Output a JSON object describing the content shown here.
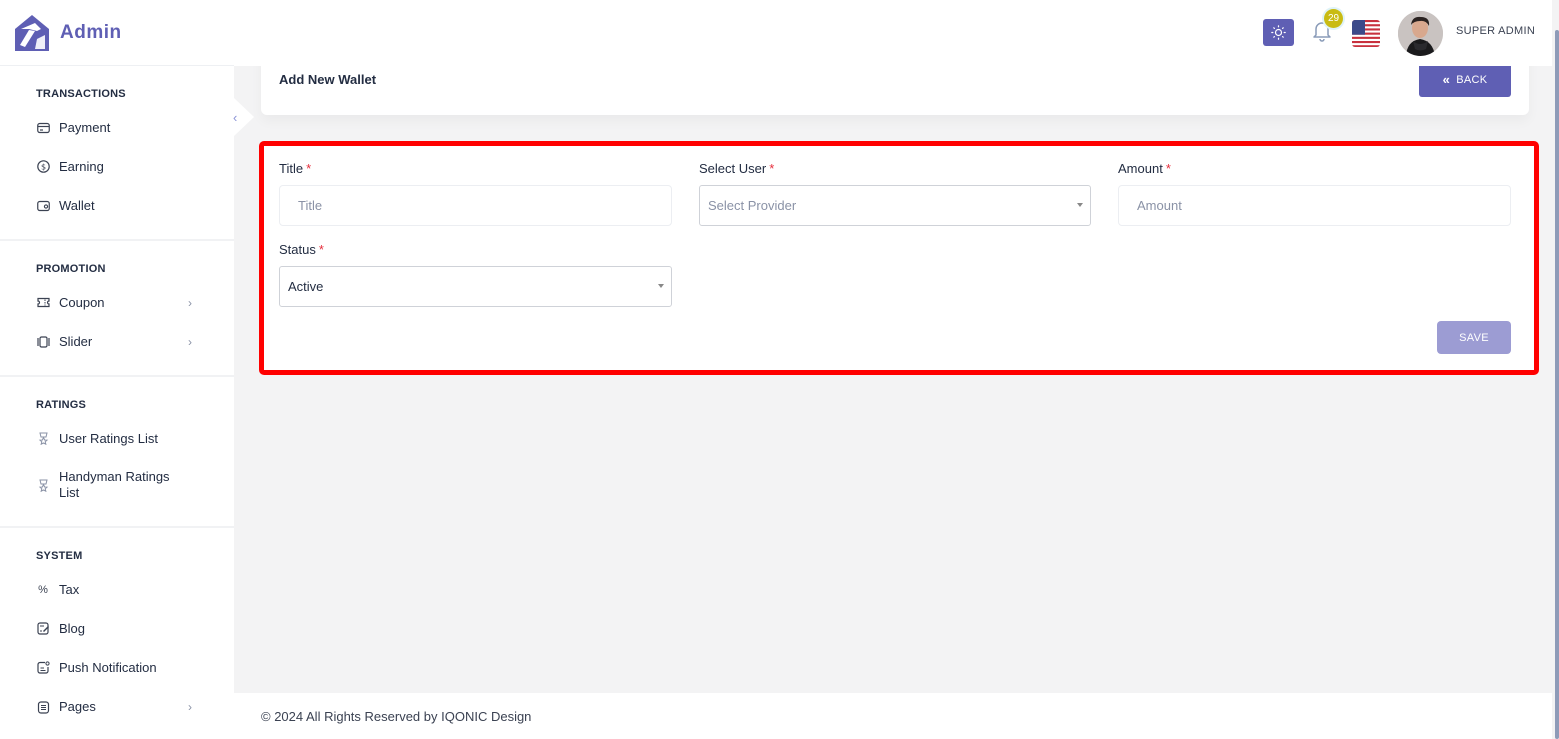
{
  "app": {
    "name": "Admin"
  },
  "sidebar": {
    "sections": [
      {
        "heading": "TRANSACTIONS",
        "items": [
          {
            "label": "Payment",
            "icon": "credit-card-icon",
            "has_submenu": false
          },
          {
            "label": "Earning",
            "icon": "dollar-circle-icon",
            "has_submenu": false
          },
          {
            "label": "Wallet",
            "icon": "wallet-icon",
            "has_submenu": false
          }
        ]
      },
      {
        "heading": "PROMOTION",
        "items": [
          {
            "label": "Coupon",
            "icon": "ticket-icon",
            "has_submenu": true
          },
          {
            "label": "Slider",
            "icon": "slider-icon",
            "has_submenu": true
          }
        ]
      },
      {
        "heading": "RATINGS",
        "items": [
          {
            "label": "User Ratings List",
            "icon": "medal-star-icon",
            "has_submenu": false
          },
          {
            "label": "Handyman Ratings List",
            "icon": "medal-star-icon",
            "has_submenu": false
          }
        ]
      },
      {
        "heading": "SYSTEM",
        "items": [
          {
            "label": "Tax",
            "icon": "percent-icon",
            "has_submenu": false
          },
          {
            "label": "Blog",
            "icon": "edit-note-icon",
            "has_submenu": false
          },
          {
            "label": "Push Notification",
            "icon": "notification-message-icon",
            "has_submenu": false
          },
          {
            "label": "Pages",
            "icon": "pages-icon",
            "has_submenu": true
          }
        ]
      }
    ]
  },
  "topbar": {
    "notification_count": "29",
    "user_name": "SUPER ADMIN",
    "language": "en-US",
    "accent_color": "#5f5fb4"
  },
  "page": {
    "title": "Add New Wallet",
    "back_label": "BACK"
  },
  "form": {
    "title": {
      "label": "Title",
      "required_mark": "*",
      "placeholder": "Title",
      "value": ""
    },
    "user": {
      "label": "Select User",
      "required_mark": "*",
      "placeholder": "Select Provider",
      "value": ""
    },
    "amount": {
      "label": "Amount",
      "required_mark": "*",
      "placeholder": "Amount",
      "value": ""
    },
    "status": {
      "label": "Status",
      "required_mark": "*",
      "value": "Active"
    },
    "save_label": "SAVE"
  },
  "footer": {
    "text": "© 2024 All Rights Reserved by IQONIC Design"
  }
}
